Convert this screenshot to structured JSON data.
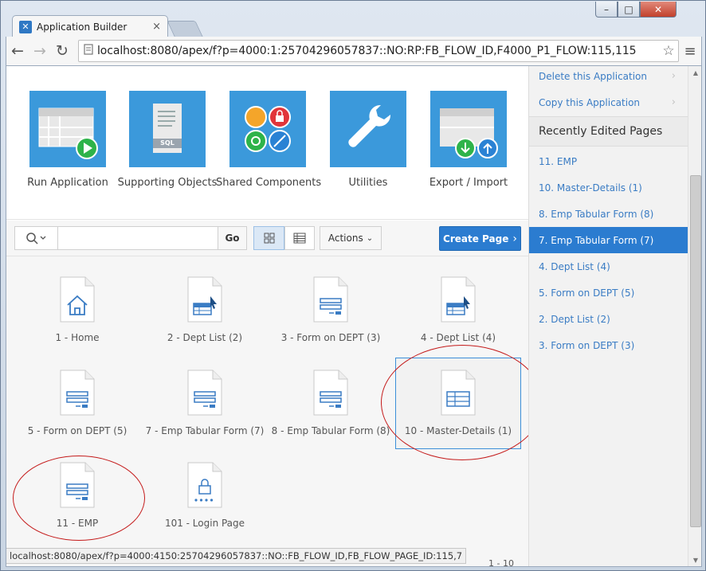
{
  "browser": {
    "tab_title": "Application Builder",
    "tab_close": "×",
    "url": "localhost:8080/apex/f?p=4000:1:25704296057837::NO:RP:FB_FLOW_ID,F4000_P1_FLOW:115,115",
    "back": "←",
    "forward": "→",
    "reload": "↻",
    "star": "☆",
    "menu": "≡",
    "window_min": "–",
    "window_max": "□",
    "window_close": "✕"
  },
  "hero": {
    "tiles": [
      {
        "label": "Run Application",
        "icon": "run-application-icon"
      },
      {
        "label": "Supporting Objects",
        "icon": "supporting-objects-icon"
      },
      {
        "label": "Shared Components",
        "icon": "shared-components-icon"
      },
      {
        "label": "Utilities",
        "icon": "utilities-icon"
      },
      {
        "label": "Export / Import",
        "icon": "export-import-icon"
      }
    ],
    "sql_label": "SQL"
  },
  "toolbar": {
    "search_placeholder": "",
    "search_value": "",
    "go_label": "Go",
    "actions_label": "Actions",
    "create_label": "Create Page",
    "view_mode": "icons"
  },
  "pages": [
    {
      "label": "1 - Home",
      "icon": "home-icon"
    },
    {
      "label": "2 - Dept List (2)",
      "icon": "report-icon"
    },
    {
      "label": "3 - Form on DEPT (3)",
      "icon": "form-icon"
    },
    {
      "label": "4 - Dept List (4)",
      "icon": "report-icon"
    },
    {
      "label": "5 - Form on DEPT (5)",
      "icon": "form-icon"
    },
    {
      "label": "7 - Emp Tabular Form (7)",
      "icon": "form-icon"
    },
    {
      "label": "8 - Emp Tabular Form (8)",
      "icon": "form-icon"
    },
    {
      "label": "10 - Master-Details (1)",
      "icon": "table-icon"
    },
    {
      "label": "11 - EMP",
      "icon": "form-icon"
    },
    {
      "label": "101 - Login Page",
      "icon": "login-icon"
    }
  ],
  "status": {
    "url": "localhost:8080/apex/f?p=4000:4150:25704296057837::NO::FB_FLOW_ID,FB_FLOW_PAGE_ID:115,7",
    "pager": "1 - 10"
  },
  "sidebar": {
    "links": [
      {
        "label": "Delete this Application"
      },
      {
        "label": "Copy this Application"
      }
    ],
    "recent_heading": "Recently Edited Pages",
    "recent": [
      {
        "label": "11. EMP"
      },
      {
        "label": "10. Master-Details (1)"
      },
      {
        "label": "8. Emp Tabular Form (8)"
      },
      {
        "label": "7. Emp Tabular Form (7)"
      },
      {
        "label": "4. Dept List (4)"
      },
      {
        "label": "5. Form on DEPT (5)"
      },
      {
        "label": "2. Dept List (2)"
      },
      {
        "label": "3. Form on DEPT (3)"
      }
    ],
    "active_index": 3
  },
  "colors": {
    "accent": "#2b7cd0",
    "tile_blue": "#3b99db",
    "link_blue": "#3a7cc4",
    "annotation_red": "#c41a1a"
  }
}
